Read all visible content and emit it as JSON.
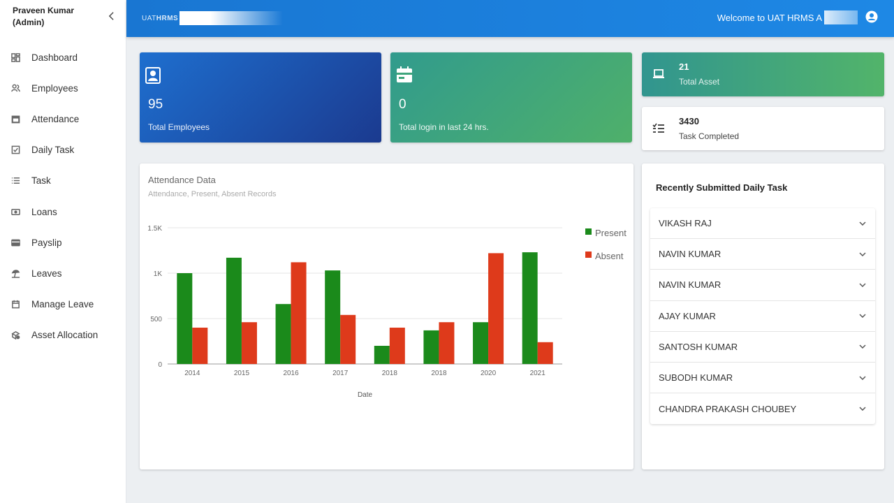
{
  "sidebar": {
    "user_name": "Praveen Kumar",
    "user_role": "(Admin)",
    "collapse_glyph": "‹",
    "items": [
      {
        "label": "Dashboard",
        "icon": "dashboard-icon"
      },
      {
        "label": "Employees",
        "icon": "people-icon"
      },
      {
        "label": "Attendance",
        "icon": "calendar-icon"
      },
      {
        "label": "Daily Task",
        "icon": "checkbox-icon"
      },
      {
        "label": "Task",
        "icon": "list-icon"
      },
      {
        "label": "Loans",
        "icon": "money-icon"
      },
      {
        "label": "Payslip",
        "icon": "payslip-icon"
      },
      {
        "label": "Leaves",
        "icon": "beach-icon"
      },
      {
        "label": "Manage Leave",
        "icon": "calendar-icon"
      },
      {
        "label": "Asset Allocation",
        "icon": "asset-icon"
      }
    ]
  },
  "header": {
    "brand_prefix": "UAT",
    "brand_name": "HRMS",
    "welcome": "Welcome to UAT HRMS A"
  },
  "stats": {
    "employees": {
      "value": "95",
      "label": "Total Employees"
    },
    "logins": {
      "value": "0",
      "label": "Total login in last 24 hrs."
    },
    "assets": {
      "value": "21",
      "label": "Total Asset"
    },
    "tasks": {
      "value": "3430",
      "label": "Task Completed"
    }
  },
  "chart": {
    "title": "Attendance Data",
    "subtitle": "Attendance, Present, Absent Records"
  },
  "chart_data": {
    "type": "bar",
    "categories": [
      "2014",
      "2015",
      "2016",
      "2017",
      "2018",
      "2018",
      "2020",
      "2021"
    ],
    "series": [
      {
        "name": "Present",
        "color": "#1b8a1b",
        "values": [
          1000,
          1170,
          660,
          1030,
          200,
          370,
          460,
          1230
        ]
      },
      {
        "name": "Absent",
        "color": "#de3a1b",
        "values": [
          400,
          460,
          1120,
          540,
          400,
          460,
          1220,
          240
        ]
      }
    ],
    "xlabel": "Date",
    "ylabel": "",
    "ylim": [
      0,
      1500
    ],
    "yticks": [
      0,
      500,
      1000,
      1500
    ],
    "ytick_labels": [
      "0",
      "500",
      "1K",
      "1.5K"
    ],
    "grid": true,
    "legend": "right"
  },
  "tasks_panel": {
    "heading": "Recently Submitted Daily Task",
    "items": [
      "VIKASH RAJ",
      "NAVIN KUMAR",
      "NAVIN KUMAR",
      "AJAY KUMAR",
      "SANTOSH KUMAR",
      "SUBODH KUMAR",
      "CHANDRA PRAKASH CHOUBEY"
    ]
  }
}
